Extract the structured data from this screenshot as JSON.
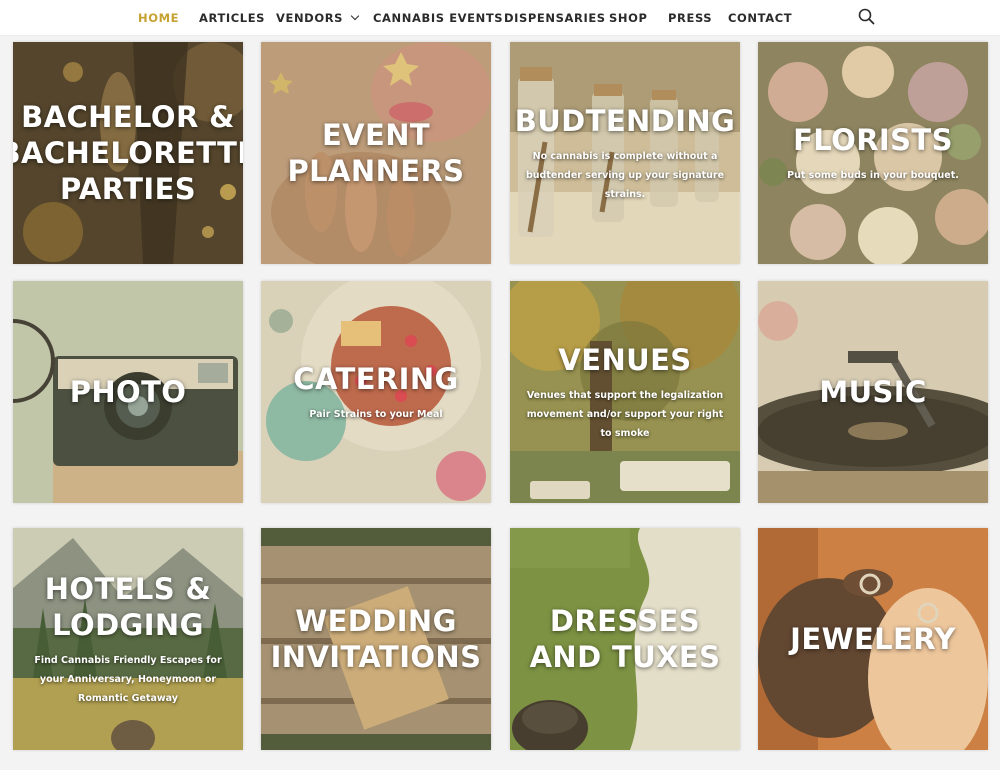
{
  "nav": {
    "items": [
      {
        "label": "HOME",
        "active": true
      },
      {
        "label": "ARTICLES"
      },
      {
        "label": "VENDORS"
      },
      {
        "label": "CANNABIS EVENTS"
      },
      {
        "label": "DISPENSARIES"
      },
      {
        "label": "SHOP"
      },
      {
        "label": "PRESS"
      },
      {
        "label": "CONTACT"
      }
    ],
    "active_color": "#c5a232",
    "search_icon": "search-icon"
  },
  "tiles": [
    {
      "title": "BACHELOR & BACHELORETTE PARTIES",
      "subtitle": ""
    },
    {
      "title": "EVENT PLANNERS",
      "subtitle": ""
    },
    {
      "title": "BUDTENDING",
      "subtitle": "No cannabis is complete without a budtender serving up your signature strains."
    },
    {
      "title": "FLORISTS",
      "subtitle": "Put some buds in your bouquet."
    },
    {
      "title": "PHOTO",
      "subtitle": ""
    },
    {
      "title": "CATERING",
      "subtitle": "Pair Strains to your Meal"
    },
    {
      "title": "VENUES",
      "subtitle": "Venues that support the legalization movement and/or support your right to smoke"
    },
    {
      "title": "MUSIC",
      "subtitle": ""
    },
    {
      "title": "HOTELS & LODGING",
      "subtitle": "Find Cannabis Friendly Escapes for your Anniversary, Honeymoon or Romantic Getaway"
    },
    {
      "title": "WEDDING INVITATIONS",
      "subtitle": ""
    },
    {
      "title": "DRESSES AND TUXES",
      "subtitle": ""
    },
    {
      "title": "JEWELERY",
      "subtitle": ""
    }
  ]
}
